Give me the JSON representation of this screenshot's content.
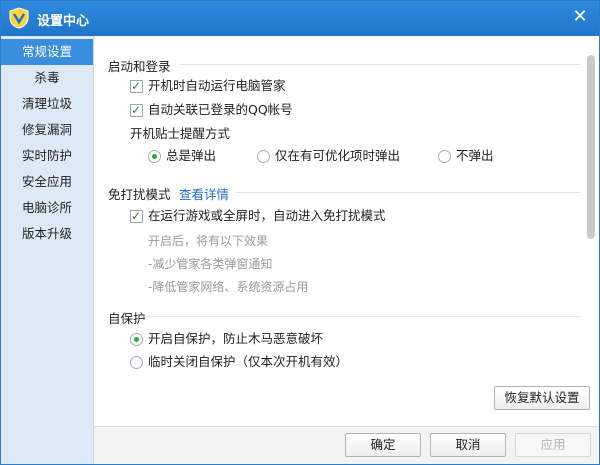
{
  "window": {
    "title": "设置中心",
    "close_glyph": "✕"
  },
  "sidebar": {
    "items": [
      {
        "label": "常规设置",
        "active": true
      },
      {
        "label": "杀毒"
      },
      {
        "label": "清理垃圾"
      },
      {
        "label": "修复漏洞"
      },
      {
        "label": "实时防护"
      },
      {
        "label": "安全应用"
      },
      {
        "label": "电脑诊所"
      },
      {
        "label": "版本升级"
      }
    ]
  },
  "startup": {
    "title": "启动和登录",
    "auto_run": {
      "label": "开机时自动运行电脑管家",
      "checked": true
    },
    "link_qq": {
      "label": "自动关联已登录的QQ帐号",
      "checked": true
    },
    "tips_label": "开机贴士提醒方式",
    "tips_options": [
      {
        "label": "总是弹出",
        "selected": true
      },
      {
        "label": "仅在有可优化项时弹出",
        "selected": false
      },
      {
        "label": "不弹出",
        "selected": false
      }
    ]
  },
  "nodisturb": {
    "title": "免打扰模式",
    "link": "查看详情",
    "auto_enter": {
      "label": "在运行游戏或全屏时，自动进入免打扰模式",
      "checked": true
    },
    "effects": [
      "开启后，将有以下效果",
      "-减少管家各类弹窗通知",
      "-降低管家网络、系统资源占用"
    ]
  },
  "selfprotect": {
    "title": "自保护",
    "options": [
      {
        "label": "开启自保护，防止木马恶意破坏",
        "selected": true
      },
      {
        "label": "临时关闭自保护（仅本次开机有效）",
        "selected": false
      }
    ]
  },
  "buttons": {
    "restore_default": "恢复默认设置",
    "ok": "确定",
    "cancel": "取消",
    "apply": "应用"
  },
  "colors": {
    "titlebar": "#1f74c9",
    "sidebar_active": "#3a8ee0",
    "sidebar_bg": "#dde9f6",
    "link": "#1f6fc8",
    "radio_selected": "#1fae3e"
  },
  "icons": {
    "logo": "shield-logo-icon",
    "close": "close-icon",
    "check": "check-icon"
  }
}
